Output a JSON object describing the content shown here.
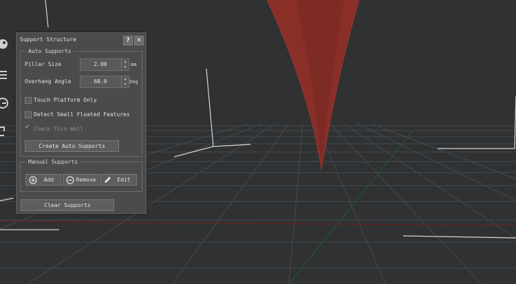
{
  "panel": {
    "title": "Support Structure",
    "help_label": "?",
    "close_label": "✕"
  },
  "auto": {
    "legend": "Auto Supports",
    "pillar_label": "Pillar Size",
    "pillar_value": "2.00",
    "pillar_unit": "mm",
    "angle_label": "Overhang Angle",
    "angle_value": "60.0",
    "angle_unit": "Deg",
    "touch_label": "Touch Platform Only",
    "detect_label": "Detect Small Floated Features",
    "thin_label": "Check Thin Wall",
    "create_label": "Create Auto Supports"
  },
  "manual": {
    "legend": "Manual Supports",
    "add_label": "Add",
    "remove_label": "Remove",
    "edit_label": "Edit"
  },
  "clear_label": "Clear Supports",
  "toolbar": {
    "icons": [
      "paint-icon",
      "list-icon",
      "rotate-icon",
      "scale-icon"
    ]
  },
  "colors": {
    "background": "#2f3133",
    "model": "#8a2f28",
    "grid": "#4a4c4e",
    "axis_red": "#7a2020",
    "axis_green": "#1f5f22"
  }
}
